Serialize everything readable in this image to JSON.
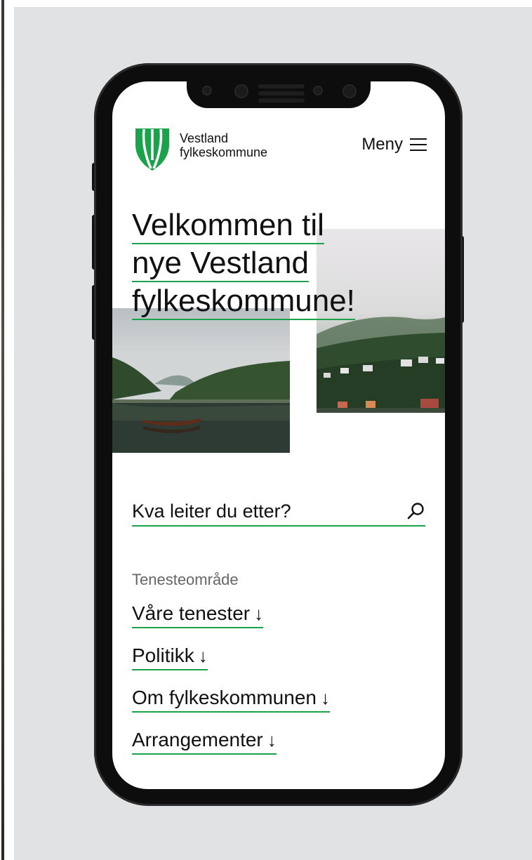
{
  "header": {
    "brand_line1": "Vestland",
    "brand_line2": "fylkeskommune",
    "menu_label": "Meny"
  },
  "hero": {
    "title_lines": [
      "Velkommen til",
      "nye Vestland",
      "fylkeskommune!"
    ]
  },
  "search": {
    "placeholder": "Kva leiter du etter?"
  },
  "services": {
    "section_label": "Tenesteområde",
    "links": [
      {
        "label": "Våre tenester",
        "arrow": "↓"
      },
      {
        "label": "Politikk",
        "arrow": "↓"
      },
      {
        "label": "Om fylkeskommunen",
        "arrow": "↓"
      },
      {
        "label": "Arrangementer",
        "arrow": "↓"
      }
    ]
  },
  "colors": {
    "accent_green": "#1aa34a",
    "background": "#e1e2e4",
    "phone_frame": "#0d0d0d"
  },
  "icons": [
    "vestland-shield-logo",
    "hamburger-menu-icon",
    "search-icon",
    "arrow-down-icon"
  ]
}
